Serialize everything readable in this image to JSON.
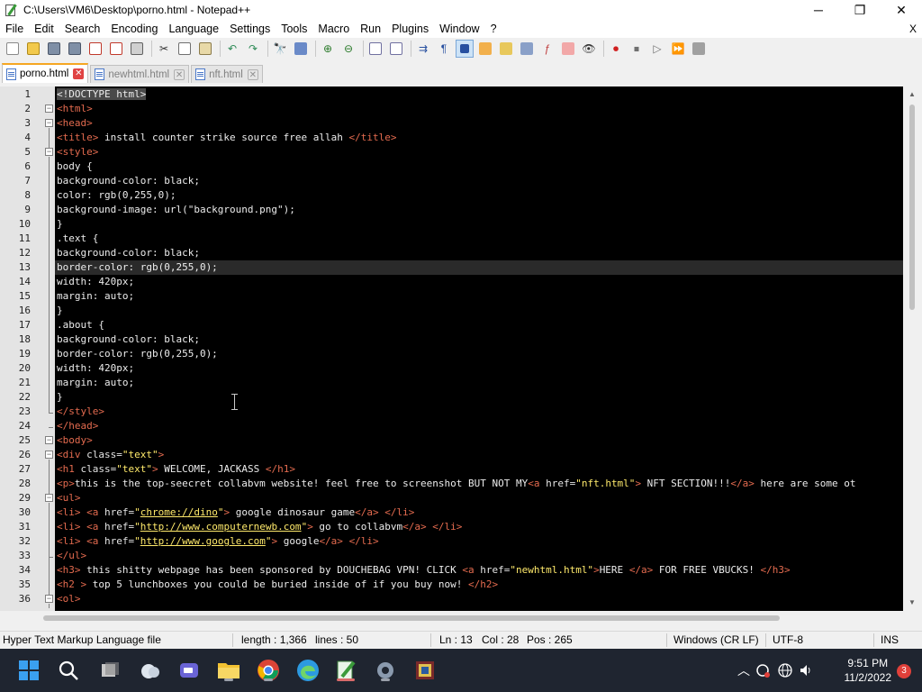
{
  "window": {
    "title": "C:\\Users\\VM6\\Desktop\\porno.html - Notepad++",
    "controls": [
      "─",
      "❐",
      "✕"
    ]
  },
  "menu": [
    "File",
    "Edit",
    "Search",
    "Encoding",
    "Language",
    "Settings",
    "Tools",
    "Macro",
    "Run",
    "Plugins",
    "Window",
    "?"
  ],
  "menu_close": "X",
  "tabs": [
    {
      "label": "porno.html",
      "active": true
    },
    {
      "label": "newhtml.html",
      "active": false
    },
    {
      "label": "nft.html",
      "active": false
    }
  ],
  "editor": {
    "current_line": 13,
    "lines": [
      {
        "n": "1",
        "html": "<span class=\"hl-doctype\">&lt;!DOCTYPE html&gt;</span>"
      },
      {
        "n": "2",
        "html": "<span class=\"tag\">&lt;html&gt;</span>"
      },
      {
        "n": "3",
        "html": "<span class=\"tag\">&lt;head&gt;</span>"
      },
      {
        "n": "4",
        "html": "<span class=\"tag\">&lt;title&gt;</span> install counter strike source free allah <span class=\"tag\">&lt;/title&gt;</span>"
      },
      {
        "n": "5",
        "html": "<span class=\"tag\">&lt;style&gt;</span>"
      },
      {
        "n": "6",
        "html": "body {"
      },
      {
        "n": "7",
        "html": "background-color: black;"
      },
      {
        "n": "8",
        "html": "color: rgb(0,255,0);"
      },
      {
        "n": "9",
        "html": "background-image: url(\"background.png\");"
      },
      {
        "n": "10",
        "html": "}"
      },
      {
        "n": "11",
        "html": ".text {"
      },
      {
        "n": "12",
        "html": "background-color: black;"
      },
      {
        "n": "13",
        "html": "border-color: rgb(0,255,0);"
      },
      {
        "n": "14",
        "html": "width: 420px;"
      },
      {
        "n": "15",
        "html": "margin: auto;"
      },
      {
        "n": "16",
        "html": "}"
      },
      {
        "n": "17",
        "html": ".about {"
      },
      {
        "n": "18",
        "html": "background-color: black;"
      },
      {
        "n": "19",
        "html": "border-color: rgb(0,255,0);"
      },
      {
        "n": "20",
        "html": "width: 420px;"
      },
      {
        "n": "21",
        "html": "margin: auto;"
      },
      {
        "n": "22",
        "html": "}"
      },
      {
        "n": "23",
        "html": "<span class=\"tag\">&lt;/style&gt;</span>"
      },
      {
        "n": "24",
        "html": "<span class=\"tag\">&lt;/head&gt;</span>"
      },
      {
        "n": "25",
        "html": "<span class=\"tag\">&lt;body&gt;</span>"
      },
      {
        "n": "26",
        "html": "<span class=\"tag\">&lt;div</span> <span class=\"attr\">class=</span><span class=\"aval\">\"text\"</span><span class=\"tag\">&gt;</span>"
      },
      {
        "n": "27",
        "html": "<span class=\"tag\">&lt;h1</span> <span class=\"attr\">class=</span><span class=\"aval\">\"text\"</span><span class=\"tag\">&gt;</span> WELCOME, JACKASS <span class=\"tag\">&lt;/h1&gt;</span>"
      },
      {
        "n": "28",
        "html": "<span class=\"tag\">&lt;p&gt;</span>this is the top-seecret collabvm website! feel free to screenshot BUT NOT MY<span class=\"tag\">&lt;a</span> <span class=\"attr\">href=</span><span class=\"aval\">\"nft.html\"</span><span class=\"tag\">&gt;</span> NFT SECTION!!!<span class=\"tag\">&lt;/a&gt;</span> here are some ot"
      },
      {
        "n": "29",
        "html": "<span class=\"tag\">&lt;ul&gt;</span>"
      },
      {
        "n": "30",
        "html": "<span class=\"tag\">&lt;li&gt;</span> <span class=\"tag\">&lt;a</span> <span class=\"attr\">href=</span><span class=\"aval\">\"<span class=\"link\">chrome://dino</span>\"</span><span class=\"tag\">&gt;</span> google dinosaur game<span class=\"tag\">&lt;/a&gt;</span> <span class=\"tag\">&lt;/li&gt;</span>"
      },
      {
        "n": "31",
        "html": "<span class=\"tag\">&lt;li&gt;</span> <span class=\"tag\">&lt;a</span> <span class=\"attr\">href=</span><span class=\"aval\">\"<span class=\"link\">http://www.computernewb.com</span>\"</span><span class=\"tag\">&gt;</span> go to collabvm<span class=\"tag\">&lt;/a&gt;</span> <span class=\"tag\">&lt;/li&gt;</span>"
      },
      {
        "n": "32",
        "html": "<span class=\"tag\">&lt;li&gt;</span> <span class=\"tag\">&lt;a</span> <span class=\"attr\">href=</span><span class=\"aval\">\"<span class=\"link\">http://www.google.com</span>\"</span><span class=\"tag\">&gt;</span> google<span class=\"tag\">&lt;/a&gt;</span> <span class=\"tag\">&lt;/li&gt;</span>"
      },
      {
        "n": "33",
        "html": "<span class=\"tag\">&lt;/ul&gt;</span>"
      },
      {
        "n": "34",
        "html": "<span class=\"tag\">&lt;h3&gt;</span> this shitty webpage has been sponsored by DOUCHEBAG VPN! CLICK <span class=\"tag\">&lt;a</span> <span class=\"attr\">href=</span><span class=\"aval\">\"newhtml.html\"</span><span class=\"tag\">&gt;</span>HERE <span class=\"tag\">&lt;/a&gt;</span> FOR FREE VBUCKS! <span class=\"tag\">&lt;/h3&gt;</span>"
      },
      {
        "n": "35",
        "html": "<span class=\"tag\">&lt;h2 &gt;</span> top 5 lunchboxes you could be buried inside of if you buy now! <span class=\"tag\">&lt;/h2&gt;</span>"
      },
      {
        "n": "36",
        "html": "<span class=\"tag\">&lt;ol&gt;</span>"
      }
    ]
  },
  "status": {
    "filetype": "Hyper Text Markup Language file",
    "length": "length : 1,366",
    "lines": "lines : 50",
    "ln": "Ln : 13",
    "col": "Col : 28",
    "pos": "Pos : 265",
    "eol": "Windows (CR LF)",
    "encoding": "UTF-8",
    "mode": "INS"
  },
  "taskbar": {
    "clock_time": "9:51 PM",
    "clock_date": "11/2/2022",
    "notification_count": "3"
  },
  "colors": {
    "accent": "#f5a623",
    "tag": "#e46b4f",
    "attr_value": "#ffea6b"
  }
}
